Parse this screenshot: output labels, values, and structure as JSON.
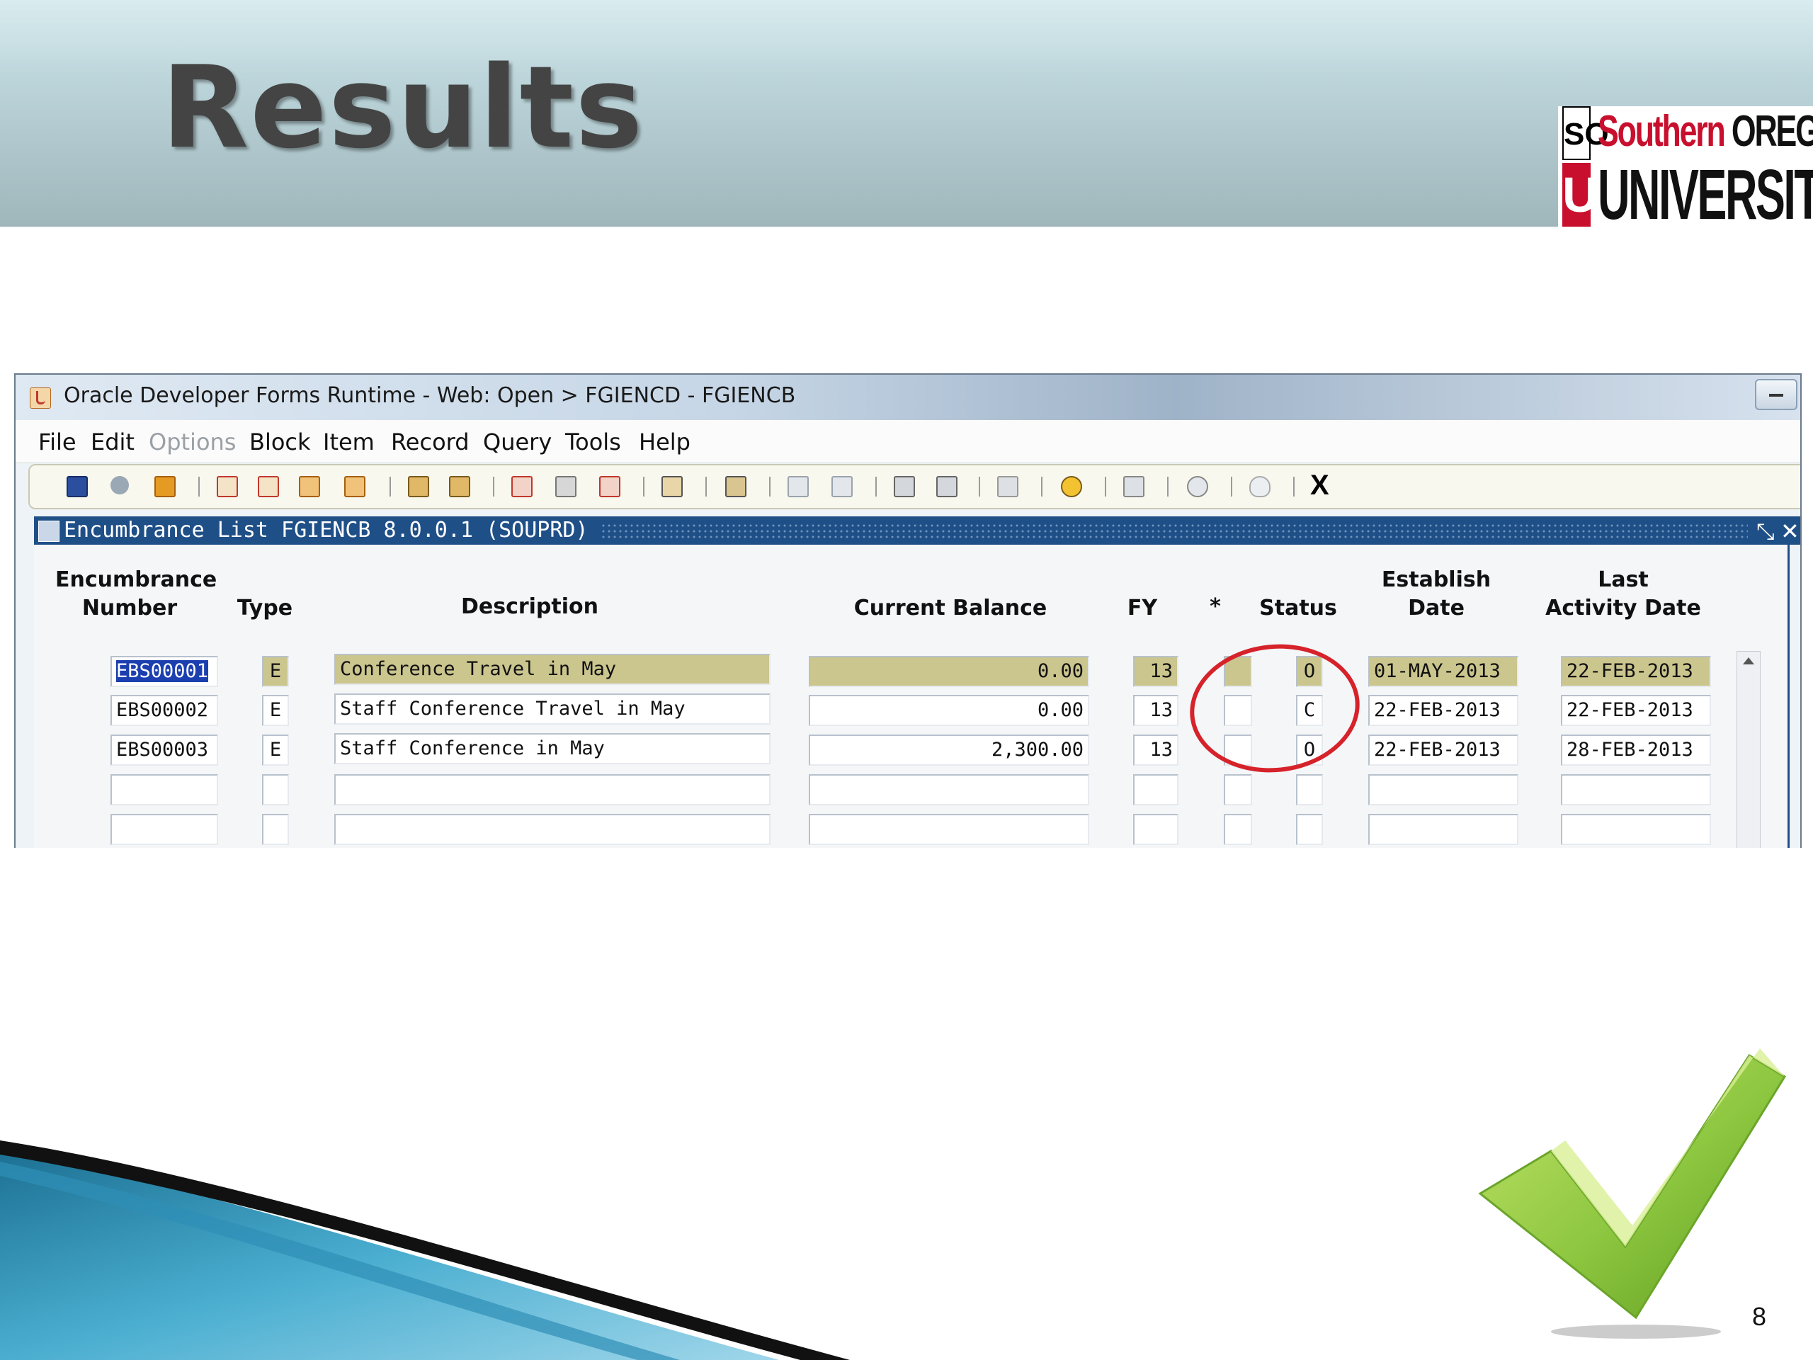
{
  "slide": {
    "title": "Results",
    "page_number": "8",
    "logo": {
      "line1_a": "Southern",
      "line1_b": "OREGON",
      "line2": "UNIVERSITY",
      "so": "SO",
      "u": "U"
    }
  },
  "window": {
    "title": "Oracle Developer Forms Runtime - Web:  Open > FGIENCD - FGIENCB"
  },
  "menu": {
    "file": "File",
    "edit": "Edit",
    "options": "Options",
    "block": "Block",
    "item": "Item",
    "record": "Record",
    "query": "Query",
    "tools": "Tools",
    "help": "Help"
  },
  "toolbar": {
    "exit_label": "X"
  },
  "form": {
    "title": "Encumbrance List  FGIENCB  8.0.0.1  (SOUPRD)",
    "columns": {
      "enc_line1": "Encumbrance",
      "enc_line2": "Number",
      "type": "Type",
      "description": "Description",
      "balance": "Current Balance",
      "fy": "FY",
      "star": "*",
      "status": "Status",
      "est_line1": "Establish",
      "est_line2": "Date",
      "last_line1": "Last",
      "last_line2": "Activity Date"
    },
    "rows": [
      {
        "number": "EBS00001",
        "type": "E",
        "description": "Conference Travel in May",
        "balance": "0.00",
        "fy": "13",
        "star": "",
        "status": "O",
        "established": "01-MAY-2013",
        "last_activity": "22-FEB-2013"
      },
      {
        "number": "EBS00002",
        "type": "E",
        "description": "Staff Conference Travel in May",
        "balance": "0.00",
        "fy": "13",
        "star": "",
        "status": "C",
        "established": "22-FEB-2013",
        "last_activity": "22-FEB-2013"
      },
      {
        "number": "EBS00003",
        "type": "E",
        "description": "Staff Conference in May",
        "balance": "2,300.00",
        "fy": "13",
        "star": "",
        "status": "O",
        "established": "22-FEB-2013",
        "last_activity": "28-FEB-2013"
      },
      {
        "number": "",
        "type": "",
        "description": "",
        "balance": "",
        "fy": "",
        "star": "",
        "status": "",
        "established": "",
        "last_activity": ""
      },
      {
        "number": "",
        "type": "",
        "description": "",
        "balance": "",
        "fy": "",
        "star": "",
        "status": "",
        "established": "",
        "last_activity": ""
      }
    ]
  },
  "colors": {
    "form_header": "#1f4f87",
    "current_record": "#cbc58e",
    "selection": "#1c3fb0",
    "annotation_circle": "#d6222a",
    "logo_red": "#c8102e",
    "check_green": "#8cc63f"
  }
}
